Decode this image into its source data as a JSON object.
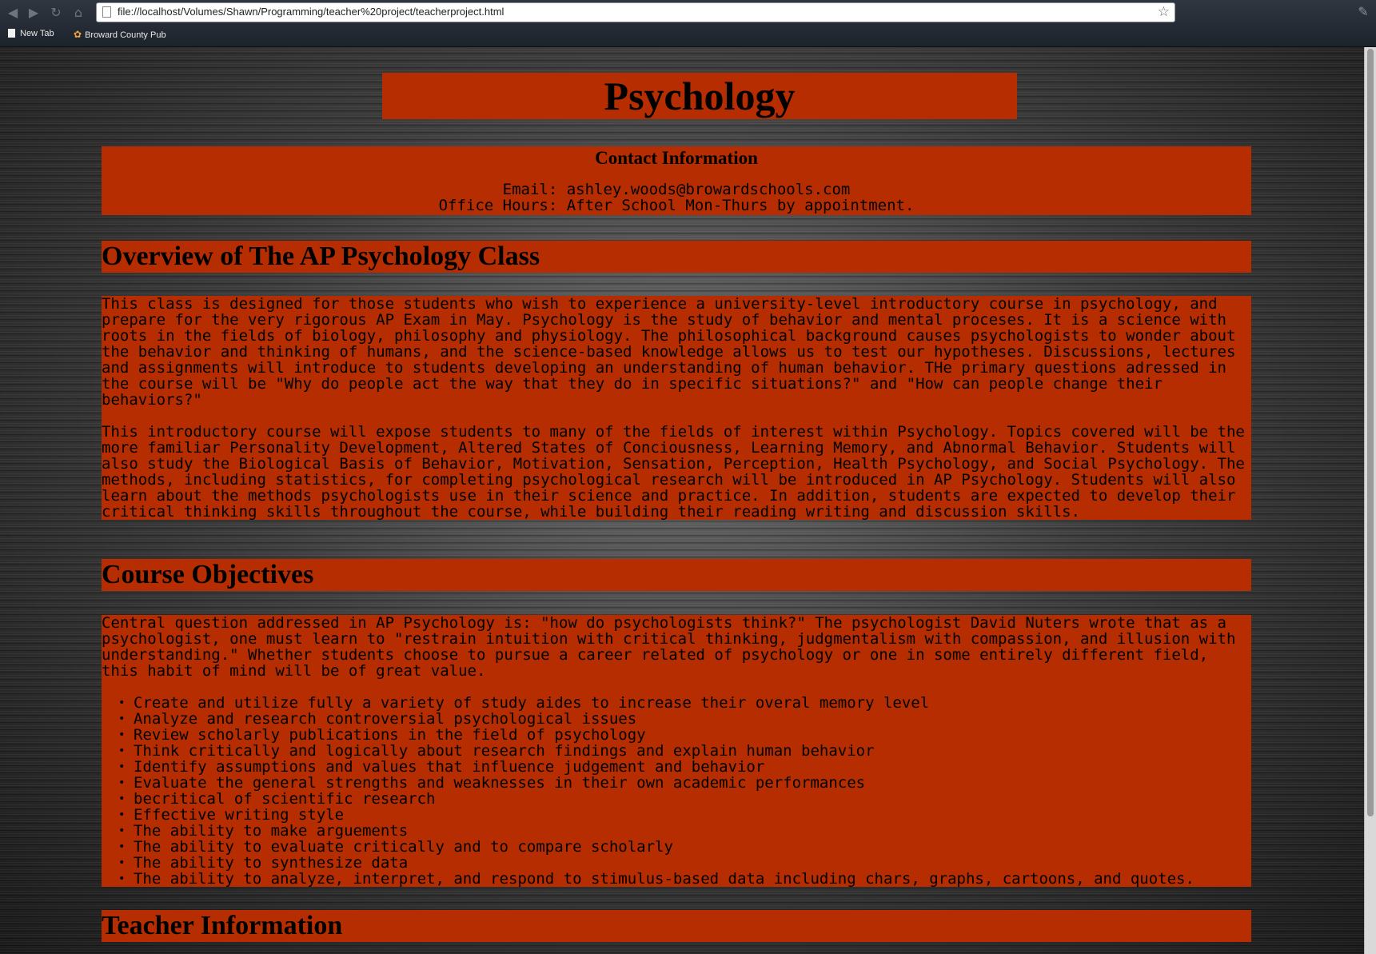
{
  "browser": {
    "url": "file://localhost/Volumes/Shawn/Programming/teacher%20project/teacherproject.html",
    "bookmarks": [
      "New Tab",
      "Broward County Pub"
    ]
  },
  "page": {
    "title": "Psychology",
    "contact": {
      "heading": "Contact Information",
      "email": "Email: ashley.woods@browardschools.com",
      "office_hours": "Office Hours: After School Mon-Thurs by appointment."
    },
    "overview": {
      "heading": "Overview of The AP Psychology Class",
      "paragraphs": [
        "This class is designed for those students who wish to experience a university-level introductory course in psychology, and prepare for the very rigorous AP Exam in May. Psychology is the study of behavior and mental proceses. It is a science with roots in the fields of biology, philosophy and physiology. The philosophical background causes psychologists to wonder about the behavior and thinking of humans, and the science-based knowledge allows us to test our hypotheses. Discussions, lectures and assignments will introduce to students developing an understanding of human behavior. THe primary questions adressed in the course will be \"Why do people act the way that they do in specific situations?\" and \"How can people change their behaviors?\"",
        "This introductory course will expose students to many of the fields of interest within Psychology. Topics covered will be the more familiar Personality Development, Altered States of Conciousness, Learning Memory, and Abnormal Behavior. Students will also study the Biological Basis of Behavior, Motivation, Sensation, Perception, Health Psychology, and Social Psychology. The methods, including statistics, for completing psychological research will be introduced in AP Psychology. Students will also learn about the methods psychologists use in their science and practice. In addition, students are expected to develop their critical thinking skills throughout the course, while building their reading writing and discussion skills."
      ]
    },
    "objectives": {
      "heading": "Course Objectives",
      "intro": "Central question addressed in AP Psychology is: \"how do psychologists think?\" The psychologist David Nuters wrote that as a psychologist, one must learn to \"restrain intuition with critical thinking, judgmentalism with compassion, and illusion with understanding.\" Whether students choose to pursue a career related of psychology or one in some entirely different field, this habit of mind will be of great value.",
      "items": [
        "Create and utilize fully a variety of study aides to increase their overal memory level",
        "Analyze and research controversial psychological issues",
        "Review scholarly publications in the field of psychology",
        "Think critically and logically about research findings and explain human behavior",
        "Identify assumptions and values that influence judgement and behavior",
        "Evaluate the general strengths and weaknesses in their own academic performances",
        "becritical of scientific research",
        "Effective writing style",
        "The ability to make arguements",
        "The ability to evaluate critically and to compare scholarly",
        "The ability to synthesize data",
        "The ability to analyze, interpret, and respond to stimulus-based data including chars, graphs, cartoons, and quotes."
      ]
    },
    "teacher": {
      "heading": "Teacher Information"
    }
  }
}
